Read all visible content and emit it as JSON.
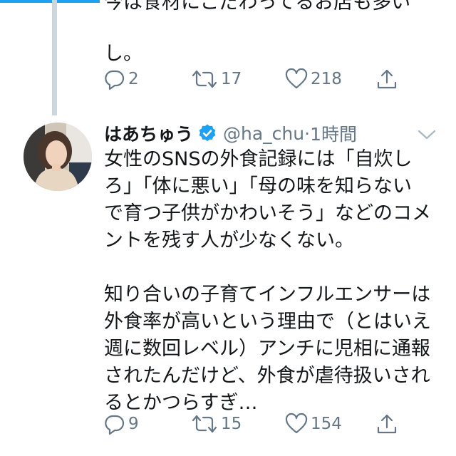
{
  "previous_tweet": {
    "text_line1": "今は食材にこだわってるお店も多い",
    "text_line2": "し。",
    "reply_count": "2",
    "retweet_count": "17",
    "like_count": "218"
  },
  "tweet": {
    "display_name": "はあちゅう",
    "handle": "@ha_chu",
    "separator": "·",
    "time": "1時間",
    "para1_lines": [
      "女性のSNSの外食記録には「自炊し",
      "ろ」「体に悪い」「母の味を知らない",
      "で育つ子供がかわいそう」などのコメ",
      "ントを残す人が少なくない。"
    ],
    "para2_lines": [
      "知り合いの子育てインフルエンサーは",
      "外食率が高いという理由で（とはいえ",
      "週に数回レベル）アンチに児相に通報",
      "されたんだけど、外食が虐待扱いされ",
      "るとかつらすぎ…"
    ],
    "reply_count": "9",
    "retweet_count": "15",
    "like_count": "154"
  },
  "colors": {
    "accent": "#1da1f2",
    "secondary_text": "#657786",
    "thread_line": "#ccd6dd"
  },
  "icons": {
    "reply": "reply-icon",
    "retweet": "retweet-icon",
    "like": "like-icon",
    "share": "share-icon",
    "verified": "verified-badge-icon",
    "more": "chevron-down-icon"
  }
}
